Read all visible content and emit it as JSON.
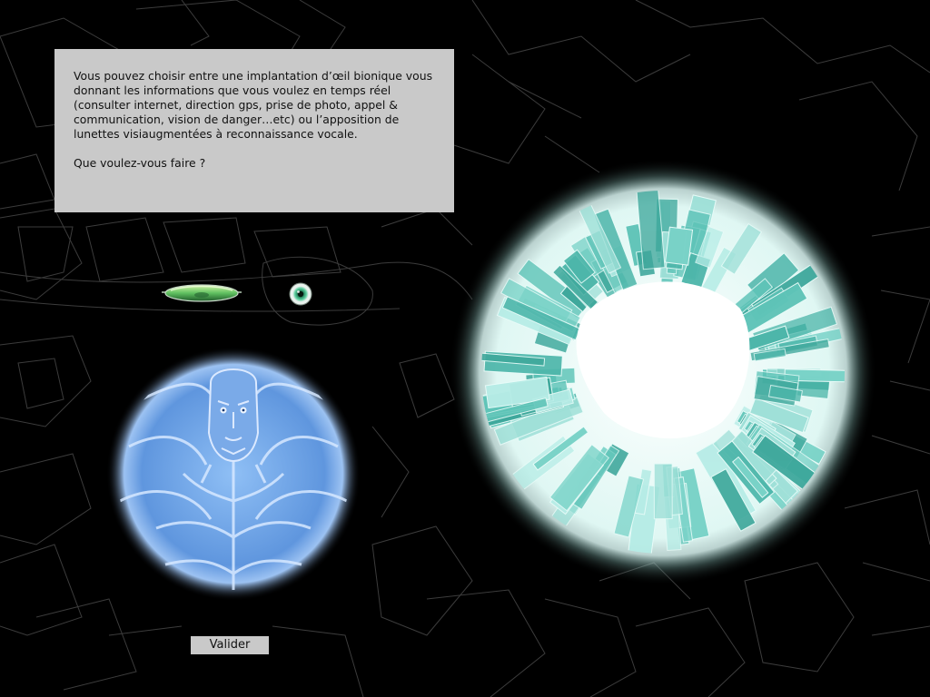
{
  "dialog": {
    "paragraph1": "Vous pouvez choisir entre une implantation d’œil bionique vous donnant les informations que vous voulez en temps réel (consulter internet, direction gps, prise de photo, appel & communication, vision de danger…etc) ou l’apposition de lunettes visiaugmentées à reconnaissance vocale.",
    "question": "Que voulez-vous faire ?"
  },
  "choices": [
    {
      "id": "glasses",
      "icon": "augmented-glasses-icon"
    },
    {
      "id": "bionic-eye",
      "icon": "bionic-eye-icon"
    }
  ],
  "actions": {
    "validate_label": "Valider"
  },
  "colors": {
    "background": "#000000",
    "panel": "#c9c9c9",
    "map_lines": "#3a3a3a",
    "body_glow": "#6fa8e8",
    "city_glow": "#8fe0d6"
  }
}
